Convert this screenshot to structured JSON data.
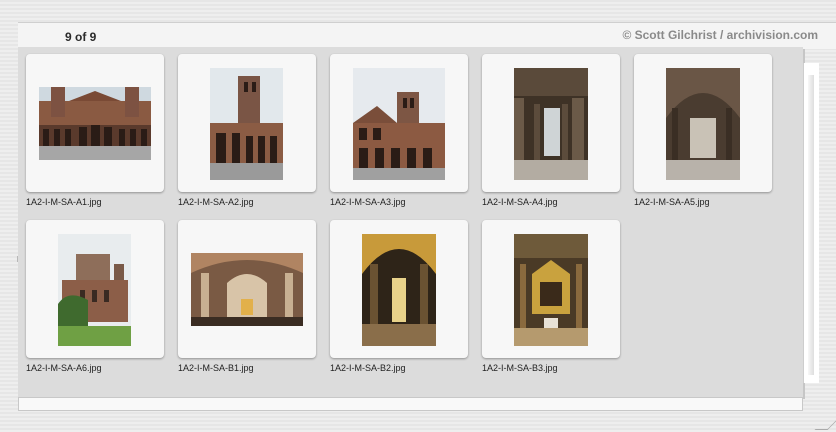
{
  "header": {
    "count": "9 of 9",
    "credit": "© Scott Gilchrist / archivision.com"
  },
  "thumbnails": [
    {
      "filename": "1A2-I-M-SA-A1.jpg",
      "icon": "courtyard-facade-photo"
    },
    {
      "filename": "1A2-I-M-SA-A2.jpg",
      "icon": "bell-tower-photo"
    },
    {
      "filename": "1A2-I-M-SA-A3.jpg",
      "icon": "tower-arcade-photo"
    },
    {
      "filename": "1A2-I-M-SA-A4.jpg",
      "icon": "portico-arches-photo"
    },
    {
      "filename": "1A2-I-M-SA-A5.jpg",
      "icon": "vaulted-portico-photo"
    },
    {
      "filename": "1A2-I-M-SA-A6.jpg",
      "icon": "apse-exterior-photo"
    },
    {
      "filename": "1A2-I-M-SA-B1.jpg",
      "icon": "nave-interior-photo"
    },
    {
      "filename": "1A2-I-M-SA-B2.jpg",
      "icon": "golden-aisle-photo"
    },
    {
      "filename": "1A2-I-M-SA-B3.jpg",
      "icon": "altar-canopy-photo"
    }
  ]
}
